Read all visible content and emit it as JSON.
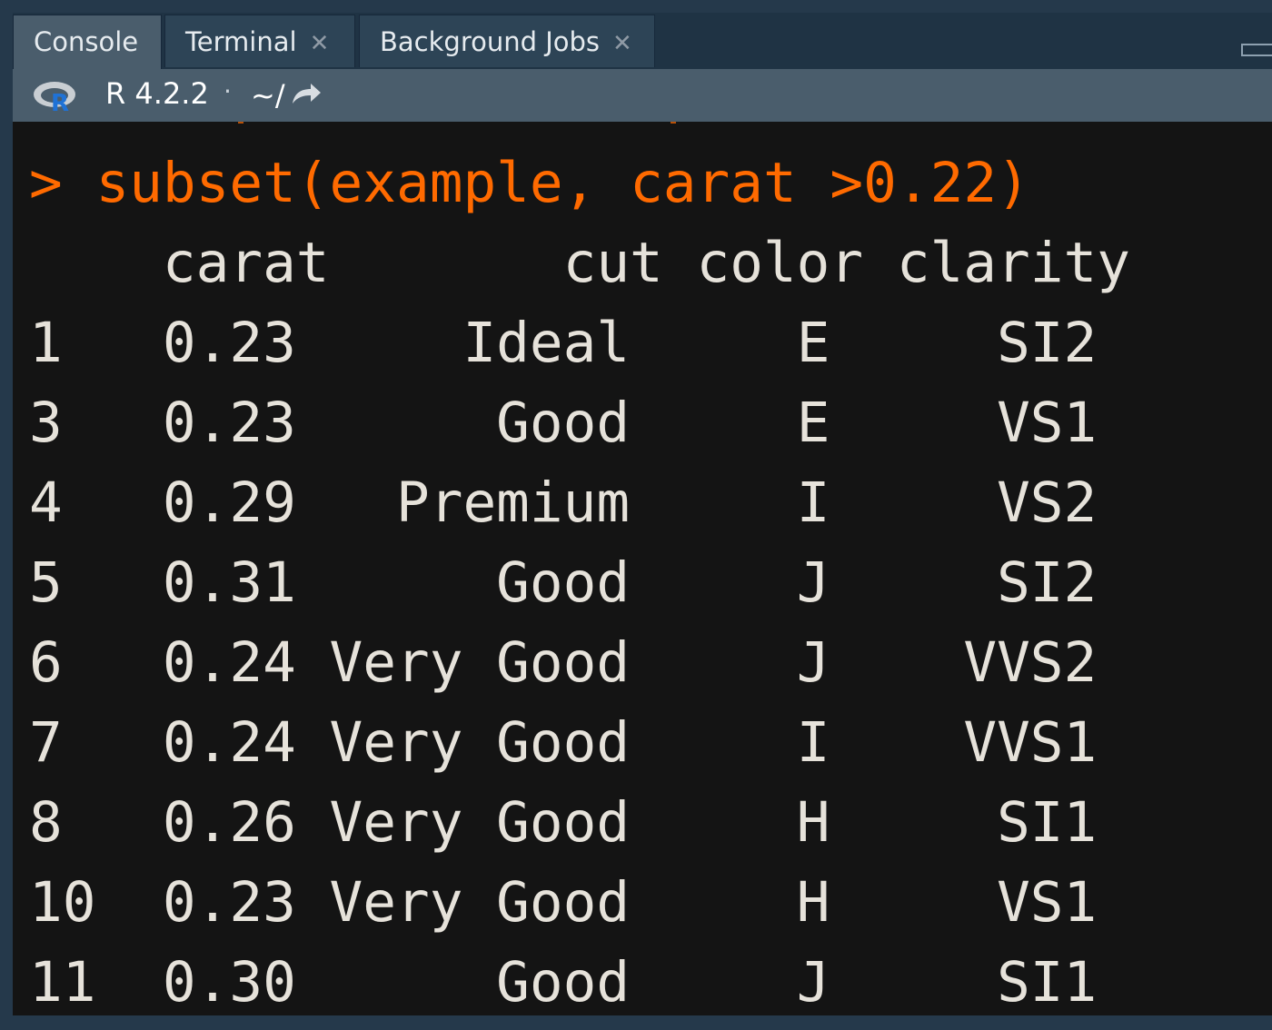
{
  "tabs": [
    {
      "label": "Console",
      "closable": false,
      "active": true
    },
    {
      "label": "Terminal",
      "closable": true,
      "active": false
    },
    {
      "label": "Background Jobs",
      "closable": true,
      "active": false
    }
  ],
  "toolbar": {
    "r_version": "R 4.2.2",
    "separator": "·",
    "working_dir": "~/",
    "icons": [
      "r-logo-icon",
      "go-to-directory-icon"
    ]
  },
  "console": {
    "prompt": ">",
    "command": "subset(example, carat >0.22)",
    "header": "    carat       cut color clarity",
    "table": {
      "columns": [
        "",
        "carat",
        "cut",
        "color",
        "clarity"
      ],
      "rows": [
        [
          "1",
          "0.23",
          "Ideal",
          "E",
          "SI2"
        ],
        [
          "3",
          "0.23",
          "Good",
          "E",
          "VS1"
        ],
        [
          "4",
          "0.29",
          "Premium",
          "I",
          "VS2"
        ],
        [
          "5",
          "0.31",
          "Good",
          "J",
          "SI2"
        ],
        [
          "6",
          "0.24",
          "Very Good",
          "J",
          "VVS2"
        ],
        [
          "7",
          "0.24",
          "Very Good",
          "I",
          "VVS1"
        ],
        [
          "8",
          "0.26",
          "Very Good",
          "H",
          "SI1"
        ],
        [
          "10",
          "0.23",
          "Very Good",
          "H",
          "VS1"
        ],
        [
          "11",
          "0.30",
          "Good",
          "J",
          "SI1"
        ]
      ]
    }
  },
  "colors": {
    "command": "#ff6a00",
    "output": "#e6e2da",
    "console_bg": "#141414",
    "toolbar_bg": "#4a5d6c",
    "tabbar_bg": "#1f3344"
  }
}
